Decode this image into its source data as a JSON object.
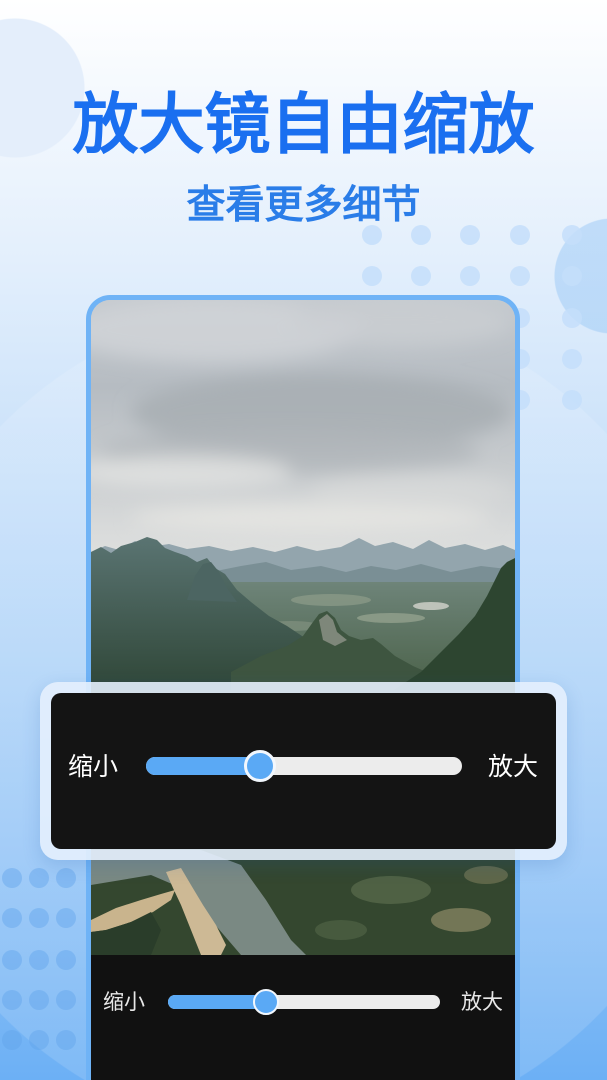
{
  "headline": {
    "title": "放大镜自由缩放",
    "subtitle": "查看更多细节"
  },
  "zoom_popup": {
    "min_label": "缩小",
    "max_label": "放大",
    "zoom_level": 0.36
  },
  "bottom_bar": {
    "min_label": "缩小",
    "max_label": "放大",
    "zoom_level": 0.36
  },
  "colors": {
    "headline": "#1a6ff0",
    "subtitle": "#2a7de8",
    "slider_fill": "#5aa9f5",
    "slider_track": "#ececec",
    "panel_background": "#141414",
    "phone_frame": "#6fb3f6"
  }
}
